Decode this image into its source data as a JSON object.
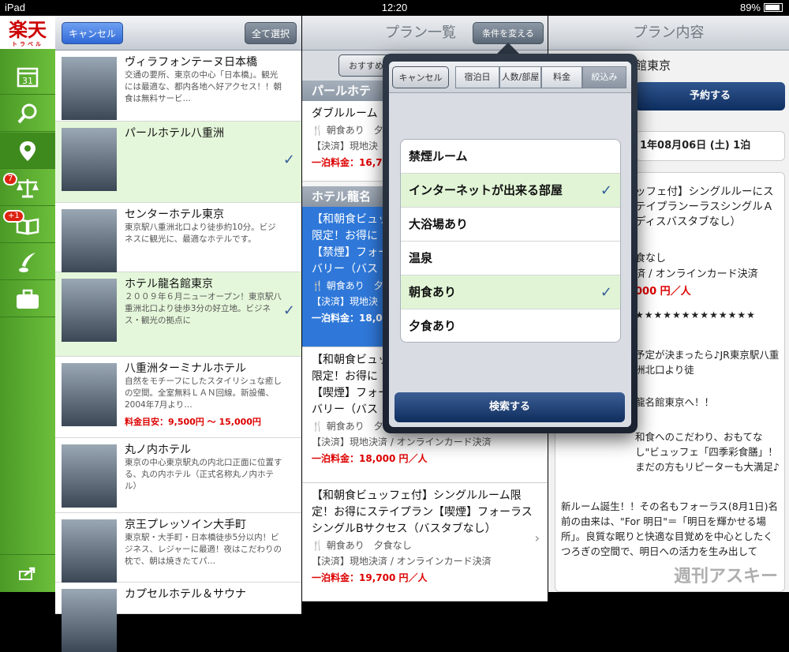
{
  "status": {
    "carrier": "iPad",
    "time": "12:20",
    "battery": "89%"
  },
  "sidebar": {
    "logo": "楽天",
    "logo_sub": "トラベル",
    "calendar_day": "31",
    "badge_compare": "7",
    "badge_book": "+1"
  },
  "list": {
    "cancel": "キャンセル",
    "select_all": "全て選択",
    "hotels": [
      {
        "name": "ヴィラフォンテーヌ日本橋",
        "desc": "交通の要所、東京の中心「日本橋」。観光には最適な、都内各地へ好アクセス！！朝食は無料サービ…",
        "price": "",
        "selected": false
      },
      {
        "name": "パールホテル八重洲",
        "desc": "",
        "price": "",
        "selected": true
      },
      {
        "name": "センターホテル東京",
        "desc": "東京駅八重洲北口より徒歩約10分。ビジネスに観光に、最適なホテルです。",
        "price": "",
        "selected": false
      },
      {
        "name": "ホテル龍名館東京",
        "desc": "２００９年６月ニューオープン！東京駅八重洲北口より徒歩3分の好立地。ビジネス・観光の拠点に",
        "price": "",
        "selected": true
      },
      {
        "name": "八重洲ターミナルホテル",
        "desc": "自然をモチーフにしたスタイリシュな癒しの空間。全室無料ＬＡＮ回線。新設備、2004年7月より…",
        "price": "料金目安：9,500円 〜 15,000円",
        "selected": false
      },
      {
        "name": "丸ノ内ホテル",
        "desc": "東京の中心東京駅丸の内北口正面に位置する、丸の内ホテル（正式名称丸ノ内ホテル）",
        "price": "",
        "selected": false
      },
      {
        "name": "京王プレッソイン大手町",
        "desc": "東京駅・大手町・日本橋徒歩5分以内！ビジネス、レジャーに最適！夜はこだわりの枕で、朝は焼きたてパ…",
        "price": "",
        "selected": false
      },
      {
        "name": "カプセルホテル＆サウナ",
        "desc": "",
        "price": "",
        "selected": false
      }
    ]
  },
  "plans": {
    "title": "プラン一覧",
    "change_cond": "条件を変える",
    "sort_btn": "おすすめ",
    "section1": "パールホテ",
    "section2": "ホテル龍名",
    "items": [
      {
        "title": "ダブルルーム",
        "meal": "朝食あり　夕",
        "pay": "【決済】現地決",
        "price": "一泊料金：16,7"
      },
      {
        "title": "【和朝食ビュッ限定！お得に【禁煙】フォーバリー（バス",
        "meal": "朝食あり　夕",
        "pay": "【決済】現地決",
        "price": "一泊料金：18,0"
      },
      {
        "title": "【和朝食ビュッ限定！お得に【喫煙】フォーバリー（バス",
        "meal": "朝食あり　夕",
        "pay": "【決済】現地決済 / オンラインカード決済",
        "price": "一泊料金：18,000 円／人"
      },
      {
        "title": "【和朝食ビュッフェ付】シングルルーム限定！お得にステイプラン【喫煙】フォーラスシングルBサクセス（バスタブなし）",
        "meal": "朝食あり　夕食なし",
        "pay": "【決済】現地決済 / オンラインカード決済",
        "price": "一泊料金：19,700 円／人"
      }
    ]
  },
  "detail": {
    "title": "プラン内容",
    "hotel": "館東京",
    "reserve": "予約する",
    "date": "1年08月06日 (土) 1泊",
    "plan_title": "ッフェ付】シングルルーにステイプランーラスシングルＡディスバスタブなし）",
    "meal": "食なし",
    "pay": "済 / オンラインカード決済",
    "price": "000 円／人",
    "stars": "★★★★★★★★★★★★★",
    "body1": "予定が決まったら♪JR東京駅八重洲北口より徒",
    "body2": "龍名館東京へ！！",
    "body3": "和食へのこだわり、おもてなし\"ビュッフェ「四季彩食膳」！まだの方もリピーターも大満足♪",
    "body4": "新ルーム誕生！！その名もフォーラス(8月1日)名前の由来は、\"For 明日\"＝「明日を輝かせる場所」。良質な眠りと快適な目覚めを中心としたくつろぎの空間で、明日への活力を生み出して"
  },
  "popover": {
    "cancel": "キャンセル",
    "tabs": [
      "宿泊日",
      "人数/部屋",
      "料金",
      "絞込み"
    ],
    "active_tab": "絞込み",
    "filters": [
      {
        "label": "禁煙ルーム",
        "on": false
      },
      {
        "label": "インターネットが出来る部屋",
        "on": true
      },
      {
        "label": "大浴場あり",
        "on": false
      },
      {
        "label": "温泉",
        "on": false
      },
      {
        "label": "朝食あり",
        "on": true
      },
      {
        "label": "夕食あり",
        "on": false
      }
    ],
    "search": "検索する"
  },
  "watermark": "週刊アスキー"
}
